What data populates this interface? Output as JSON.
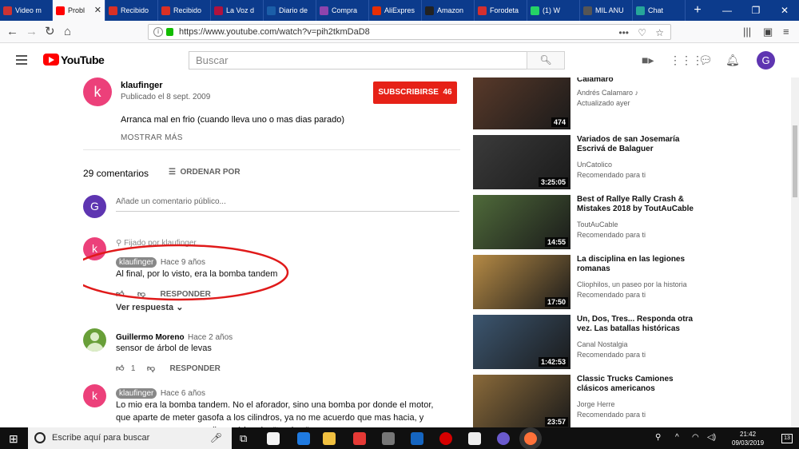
{
  "browser": {
    "tabs": [
      {
        "label": "Video m",
        "color": "#cc3333",
        "active": false
      },
      {
        "label": "Probl",
        "color": "#ff0000",
        "active": true
      },
      {
        "label": "Recibido",
        "color": "#d93025",
        "active": false
      },
      {
        "label": "Recibido",
        "color": "#d93025",
        "active": false
      },
      {
        "label": "La Voz d",
        "color": "#b0123e",
        "active": false
      },
      {
        "label": "Diario de",
        "color": "#1b5ea8",
        "active": false
      },
      {
        "label": "Compra",
        "color": "#8e44ad",
        "active": false
      },
      {
        "label": "AliExpres",
        "color": "#e62e04",
        "active": false
      },
      {
        "label": "Amazon",
        "color": "#222222",
        "active": false
      },
      {
        "label": "Forodeta",
        "color": "#d32f2f",
        "active": false
      },
      {
        "label": "(1) W",
        "color": "#25d366",
        "active": false
      },
      {
        "label": "MIL ANU",
        "color": "#555555",
        "active": false
      },
      {
        "label": "Chat",
        "color": "#26a69a",
        "active": false
      }
    ],
    "url": "https://www.youtube.com/watch?v=pih2tkmDaD8"
  },
  "header": {
    "logo_text": "YouTube",
    "search_placeholder": "Buscar",
    "avatar_letter": "G"
  },
  "channel": {
    "avatar_letter": "k",
    "name": "klaufinger",
    "published": "Publicado el 8 sept. 2009",
    "subscribe_label": "SUBSCRIBIRSE",
    "subscriber_count": "46",
    "description": "Arranca mal en frio (cuando lleva uno o mas dias parado)",
    "show_more": "MOSTRAR MÁS"
  },
  "comments_header": {
    "count": "29 comentarios",
    "sort_label": "ORDENAR POR",
    "add_placeholder": "Añade un comentario público...",
    "user_letter": "G"
  },
  "comments": [
    {
      "pinned": "Fijado por klaufinger",
      "author": "klaufinger",
      "time": "Hace 9 años",
      "text": "Al final, por lo visto, era la bomba tandem",
      "reply_label": "RESPONDER",
      "view_replies": "Ver respuesta"
    },
    {
      "author": "Guillermo Moreno",
      "time": "Hace 2 años",
      "text": "sensor de árbol de levas",
      "likes": "1",
      "reply_label": "RESPONDER"
    },
    {
      "author": "klaufinger",
      "time": "Hace 6 años",
      "text": "Lo mio era la bomba tandem. No el aforador, sino una bomba por donde el motor, que aparte de meter gasofa a los cilindros, ya no me acuerdo que mas hacia, y supongo que por eso se llamará bomba \"tandem\""
    }
  ],
  "sidebar_videos": [
    {
      "title": "Calamaro",
      "channel": "Andrés Calamaro ♪",
      "meta": "Actualizado ayer",
      "duration": "474",
      "color": "#5a3a2a"
    },
    {
      "title": "Variados de san Josemaría Escrivá de Balaguer",
      "channel": "UnCatolico",
      "meta": "Recomendado para ti",
      "duration": "3:25:05",
      "color": "#3b3b3b"
    },
    {
      "title": "Best of Rallye Rally Crash & Mistakes 2018 by ToutAuCable",
      "channel": "ToutAuCable",
      "meta": "Recomendado para ti",
      "duration": "14:55",
      "color": "#4f6a3a"
    },
    {
      "title": "La disciplina en las legiones romanas",
      "channel": "Cliophilos, un paseo por la historia",
      "meta": "Recomendado para ti",
      "duration": "17:50",
      "color": "#b58a45"
    },
    {
      "title": "Un, Dos, Tres... Responda otra vez. Las batallas históricas",
      "channel": "Canal Nostalgia",
      "meta": "Recomendado para ti",
      "duration": "1:42:53",
      "color": "#3c5670"
    },
    {
      "title": "Classic Trucks Camiones clásicos americanos",
      "channel": "Jorge Herre",
      "meta": "Recomendado para ti",
      "duration": "23:57",
      "color": "#8a6a3a"
    }
  ],
  "taskbar": {
    "search_placeholder": "Escribe aquí para buscar",
    "time": "21:42",
    "date": "09/03/2019",
    "notifications": "13"
  },
  "colors": {
    "accent_red": "#e62117",
    "annotation_ellipse": "#e01a1a",
    "author_badge": "#888888"
  }
}
